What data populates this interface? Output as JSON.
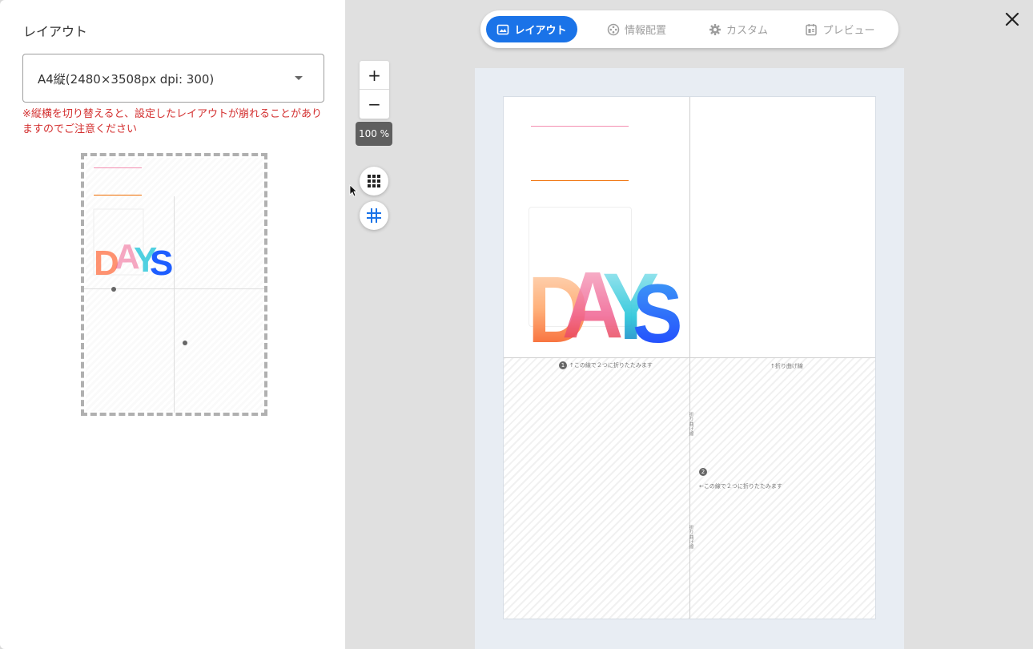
{
  "left_panel": {
    "title": "レイアウト",
    "select_value": "A4縦(2480×3508px dpi: 300)",
    "warning": "※縦横を切り替えると、設定したレイアウトが崩れることがありますのでご注意ください"
  },
  "tabs": [
    {
      "label": "レイアウト",
      "icon": "image-icon",
      "active": true
    },
    {
      "label": "情報配置",
      "icon": "film-reel-icon",
      "active": false
    },
    {
      "label": "カスタム",
      "icon": "gear-icon",
      "active": false
    },
    {
      "label": "プレビュー",
      "icon": "preview-icon",
      "active": false
    }
  ],
  "zoom": {
    "plus": "+",
    "minus": "−",
    "level": "100 %"
  },
  "page": {
    "logo_text": "DAYS",
    "fold_text_1": "↑この線で２つに折りたたみます",
    "fold_text_1_num": "1",
    "fold_text_2": "↑折り曲げ線",
    "fold_text_3": "←この線で２つに折りたたみます",
    "fold_text_3_num": "2",
    "vertical_text": "折り曲げ線"
  },
  "colors": {
    "accent": "#1a73e8",
    "warning": "#d32f2f"
  }
}
